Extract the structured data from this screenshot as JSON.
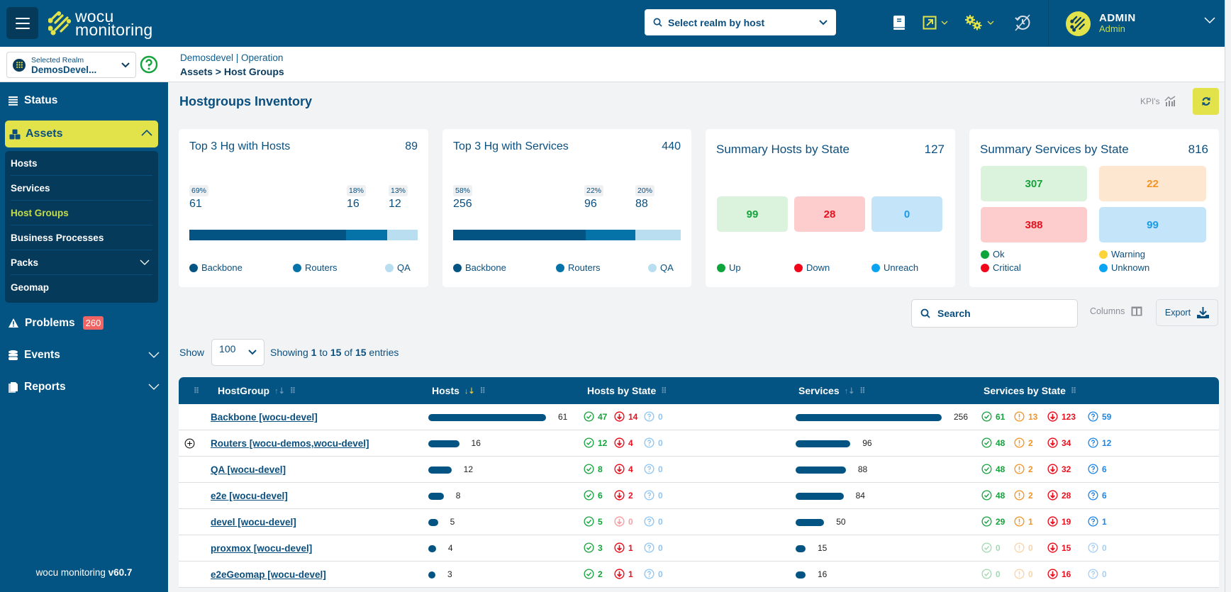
{
  "app": {
    "logo_line1": "wocu",
    "logo_line2": "monitoring",
    "version_prefix": "wocu monitoring",
    "version": "v60.7"
  },
  "header": {
    "realm_search_placeholder": "Select realm by host",
    "user_name": "ADMIN",
    "user_role": "Admin"
  },
  "realm": {
    "label": "Selected Realm",
    "value": "DemosDevel..."
  },
  "breadcrumb": {
    "context": "Demosdevel | Operation",
    "path": "Assets > Host Groups"
  },
  "sidebar": {
    "status": "Status",
    "assets": "Assets",
    "assets_items": [
      {
        "label": "Hosts",
        "active": false
      },
      {
        "label": "Services",
        "active": false
      },
      {
        "label": "Host Groups",
        "active": true
      },
      {
        "label": "Business Processes",
        "active": false
      },
      {
        "label": "Packs",
        "active": false
      },
      {
        "label": "Geomap",
        "active": false
      }
    ],
    "problems": "Problems",
    "problems_count": "260",
    "events": "Events",
    "reports": "Reports"
  },
  "page": {
    "title": "Hostgroups Inventory",
    "kpis_label": "KPI's"
  },
  "colors": {
    "primary": "#035483",
    "accent": "#e2e34b",
    "mid": "#0573a8",
    "light": "#b8def0",
    "ok": "#14a33c",
    "critical": "#e8101f",
    "warning": "#f39325",
    "unknown": "#1a86e8"
  },
  "cards": {
    "top_hosts": {
      "title": "Top 3 Hg with Hosts",
      "total": "89",
      "segments": [
        {
          "name": "Backbone",
          "pct": "69%",
          "value": 61
        },
        {
          "name": "Routers",
          "pct": "18%",
          "value": 16
        },
        {
          "name": "QA",
          "pct": "13%",
          "value": 12
        }
      ]
    },
    "top_services": {
      "title": "Top 3 Hg with Services",
      "total": "440",
      "segments": [
        {
          "name": "Backbone",
          "pct": "58%",
          "value": 256
        },
        {
          "name": "Routers",
          "pct": "22%",
          "value": 96
        },
        {
          "name": "QA",
          "pct": "20%",
          "value": 88
        }
      ]
    },
    "hosts_state": {
      "title": "Summary Hosts by State",
      "total": "127",
      "states": [
        {
          "name": "Up",
          "value": "99"
        },
        {
          "name": "Down",
          "value": "28"
        },
        {
          "name": "Unreach",
          "value": "0"
        }
      ]
    },
    "services_state": {
      "title": "Summary Services by State",
      "total": "816",
      "states": [
        {
          "name": "Ok",
          "value": "307"
        },
        {
          "name": "Warning",
          "value": "22"
        },
        {
          "name": "Critical",
          "value": "388"
        },
        {
          "name": "Unknown",
          "value": "99"
        }
      ]
    }
  },
  "toolbar": {
    "search_placeholder": "Search",
    "columns_label": "Columns",
    "export_label": "Export"
  },
  "paging": {
    "show_label": "Show",
    "page_size": "100",
    "showing_prefix": "Showing",
    "from": "1",
    "to_word": "to",
    "to": "15",
    "of_word": "of",
    "total": "15",
    "suffix": "entries"
  },
  "table": {
    "columns": [
      "HostGroup",
      "Hosts",
      "Hosts by State",
      "Services",
      "Services by State"
    ],
    "max_hosts": 61,
    "max_services": 256,
    "rows": [
      {
        "name": "Backbone [wocu-devel]",
        "expandable": false,
        "hosts": 61,
        "up": 47,
        "down": 14,
        "unreach": 0,
        "services": 256,
        "ok": 61,
        "warning": 13,
        "critical": 123,
        "unknown": 59
      },
      {
        "name": "Routers [wocu-demos,wocu-devel]",
        "expandable": true,
        "hosts": 16,
        "up": 12,
        "down": 4,
        "unreach": 0,
        "services": 96,
        "ok": 48,
        "warning": 2,
        "critical": 34,
        "unknown": 12
      },
      {
        "name": "QA [wocu-devel]",
        "expandable": false,
        "hosts": 12,
        "up": 8,
        "down": 4,
        "unreach": 0,
        "services": 88,
        "ok": 48,
        "warning": 2,
        "critical": 32,
        "unknown": 6
      },
      {
        "name": "e2e [wocu-devel]",
        "expandable": false,
        "hosts": 8,
        "up": 6,
        "down": 2,
        "unreach": 0,
        "services": 84,
        "ok": 48,
        "warning": 2,
        "critical": 28,
        "unknown": 6
      },
      {
        "name": "devel [wocu-devel]",
        "expandable": false,
        "hosts": 5,
        "up": 5,
        "down": 0,
        "unreach": 0,
        "services": 50,
        "ok": 29,
        "warning": 1,
        "critical": 19,
        "unknown": 1
      },
      {
        "name": "proxmox [wocu-devel]",
        "expandable": false,
        "hosts": 4,
        "up": 3,
        "down": 1,
        "unreach": 0,
        "services": 15,
        "ok": 0,
        "warning": 0,
        "critical": 15,
        "unknown": 0
      },
      {
        "name": "e2eGeomap [wocu-devel]",
        "expandable": false,
        "hosts": 3,
        "up": 2,
        "down": 1,
        "unreach": 0,
        "services": 16,
        "ok": 0,
        "warning": 0,
        "critical": 16,
        "unknown": 0
      }
    ]
  }
}
